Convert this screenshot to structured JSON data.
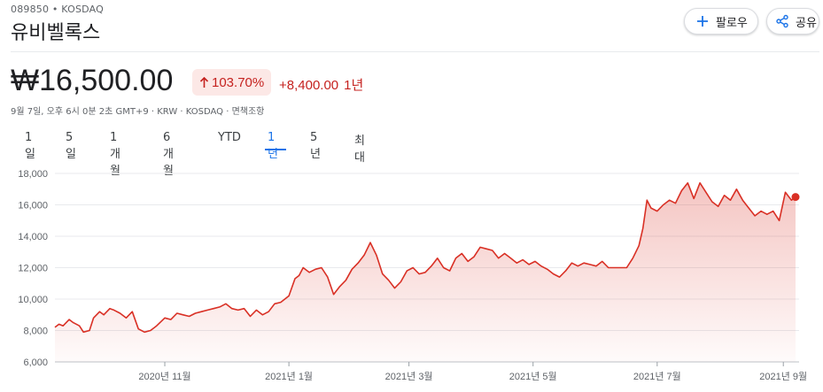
{
  "header": {
    "ticker_line": "089850 • KOSDAQ",
    "company_name": "유비벨록스",
    "follow_label": "팔로우",
    "share_label": "공유"
  },
  "quote": {
    "price": "₩16,500.00",
    "percent_change": "103.70%",
    "abs_change": "+8,400.00",
    "period": "1년",
    "meta": "9월 7일, 오후 6시 0분 2초 GMT+9 · KRW · KOSDAQ · 면책조항",
    "color_up": "#c5221f",
    "badge_bg": "#fce8e6"
  },
  "tabs": {
    "items": [
      "1일",
      "5일",
      "1개월",
      "6개월",
      "YTD",
      "1년",
      "5년",
      "최대"
    ],
    "active_index": 5
  },
  "chart_data": {
    "type": "area",
    "title": "",
    "xlabel": "",
    "ylabel": "",
    "ylim": [
      6000,
      18000
    ],
    "y_ticks": [
      6000,
      8000,
      10000,
      12000,
      14000,
      16000,
      18000
    ],
    "y_tick_labels": [
      "6,000",
      "8,000",
      "10,000",
      "12,000",
      "14,000",
      "16,000",
      "18,000"
    ],
    "x_tick_labels": [
      "2020년 11월",
      "2021년 1월",
      "2021년 3월",
      "2021년 5월",
      "2021년 7월",
      "2021년 9월"
    ],
    "x_tick_dates": [
      "2020-11-01",
      "2021-01-01",
      "2021-03-01",
      "2021-05-01",
      "2021-07-01",
      "2021-09-01"
    ],
    "x_range": [
      "2020-09-08",
      "2021-09-07"
    ],
    "grid": true,
    "line_color": "#d93025",
    "series": [
      {
        "x": [
          "2020-09-08",
          "2020-09-10",
          "2020-09-12",
          "2020-09-15",
          "2020-09-17",
          "2020-09-20",
          "2020-09-22",
          "2020-09-25",
          "2020-09-27",
          "2020-09-30",
          "2020-10-02",
          "2020-10-05",
          "2020-10-07",
          "2020-10-10",
          "2020-10-13",
          "2020-10-16",
          "2020-10-19",
          "2020-10-22",
          "2020-10-25",
          "2020-10-28",
          "2020-11-01",
          "2020-11-04",
          "2020-11-07",
          "2020-11-10",
          "2020-11-13",
          "2020-11-16",
          "2020-11-19",
          "2020-11-22",
          "2020-11-25",
          "2020-11-28",
          "2020-12-01",
          "2020-12-04",
          "2020-12-07",
          "2020-12-10",
          "2020-12-13",
          "2020-12-16",
          "2020-12-19",
          "2020-12-22",
          "2020-12-25",
          "2020-12-28",
          "2021-01-01",
          "2021-01-04",
          "2021-01-06",
          "2021-01-08",
          "2021-01-11",
          "2021-01-14",
          "2021-01-17",
          "2021-01-20",
          "2021-01-23",
          "2021-01-26",
          "2021-01-29",
          "2021-02-01",
          "2021-02-04",
          "2021-02-07",
          "2021-02-10",
          "2021-02-13",
          "2021-02-16",
          "2021-02-19",
          "2021-02-22",
          "2021-02-25",
          "2021-02-28",
          "2021-03-03",
          "2021-03-06",
          "2021-03-09",
          "2021-03-12",
          "2021-03-15",
          "2021-03-18",
          "2021-03-21",
          "2021-03-24",
          "2021-03-27",
          "2021-03-30",
          "2021-04-02",
          "2021-04-05",
          "2021-04-08",
          "2021-04-11",
          "2021-04-14",
          "2021-04-17",
          "2021-04-20",
          "2021-04-23",
          "2021-04-26",
          "2021-04-29",
          "2021-05-02",
          "2021-05-05",
          "2021-05-08",
          "2021-05-11",
          "2021-05-14",
          "2021-05-17",
          "2021-05-20",
          "2021-05-23",
          "2021-05-26",
          "2021-05-29",
          "2021-06-01",
          "2021-06-04",
          "2021-06-07",
          "2021-06-10",
          "2021-06-13",
          "2021-06-16",
          "2021-06-19",
          "2021-06-22",
          "2021-06-24",
          "2021-06-26",
          "2021-06-28",
          "2021-07-01",
          "2021-07-04",
          "2021-07-07",
          "2021-07-10",
          "2021-07-13",
          "2021-07-16",
          "2021-07-19",
          "2021-07-22",
          "2021-07-25",
          "2021-07-28",
          "2021-07-31",
          "2021-08-03",
          "2021-08-06",
          "2021-08-09",
          "2021-08-12",
          "2021-08-15",
          "2021-08-18",
          "2021-08-21",
          "2021-08-24",
          "2021-08-27",
          "2021-08-30",
          "2021-09-02",
          "2021-09-05",
          "2021-09-07"
        ],
        "y": [
          8200,
          8400,
          8300,
          8700,
          8500,
          8300,
          7900,
          8000,
          8800,
          9200,
          9000,
          9400,
          9300,
          9100,
          8800,
          9200,
          8100,
          7900,
          8000,
          8300,
          8800,
          8700,
          9100,
          9000,
          8900,
          9100,
          9200,
          9300,
          9400,
          9500,
          9700,
          9400,
          9300,
          9400,
          8900,
          9300,
          9000,
          9200,
          9700,
          9800,
          10200,
          11300,
          11500,
          12000,
          11700,
          11900,
          12000,
          11400,
          10300,
          10800,
          11200,
          11900,
          12300,
          12800,
          13600,
          12800,
          11600,
          11200,
          10700,
          11100,
          11800,
          12000,
          11600,
          11700,
          12100,
          12600,
          12000,
          11800,
          12600,
          12900,
          12400,
          12700,
          13300,
          13200,
          13100,
          12600,
          12900,
          12600,
          12300,
          12500,
          12200,
          12400,
          12100,
          11900,
          11600,
          11400,
          11800,
          12300,
          12100,
          12300,
          12200,
          12100,
          12400,
          12000,
          12000,
          12000,
          12000,
          12600,
          13400,
          14500,
          16300,
          15800,
          15600,
          16000,
          16300,
          16100,
          16900,
          17400,
          16400,
          17400,
          16800,
          16200,
          15900,
          16600,
          16300,
          17000,
          16300,
          15800,
          15300,
          15600,
          15400,
          15600,
          15000,
          16800,
          16300,
          16500
        ]
      }
    ]
  }
}
